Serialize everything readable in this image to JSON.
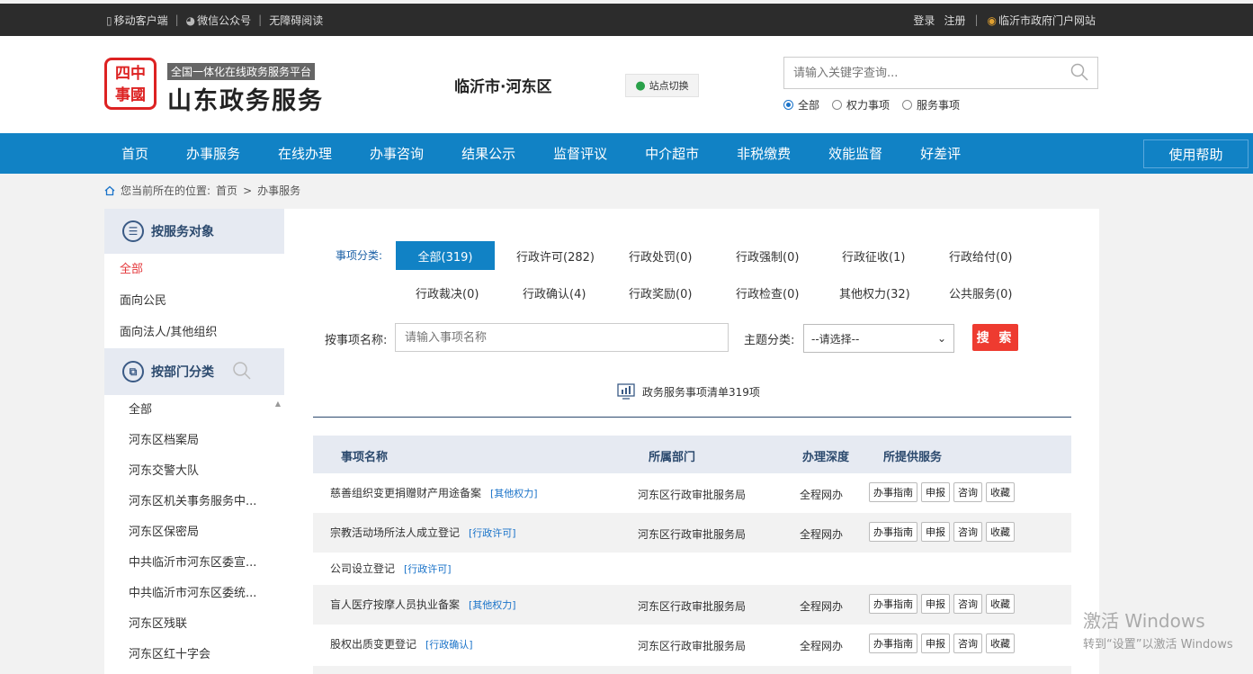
{
  "topbar": {
    "mobile": "移动客户端",
    "wechat": "微信公众号",
    "accessible": "无障碍阅读",
    "login": "登录",
    "register": "注册",
    "portal": "临沂市政府门户网站"
  },
  "header": {
    "seal_text": "四中\n事國",
    "tagline": "全国一体化在线政务服务平台",
    "brand": "山东政务服务",
    "city": "临沂市·河东区",
    "switch_label": "站点切换",
    "search_placeholder": "请输入关键字查询...",
    "radios": [
      "全部",
      "权力事项",
      "服务事项"
    ]
  },
  "nav": {
    "items": [
      "首页",
      "办事服务",
      "在线办理",
      "办事咨询",
      "结果公示",
      "监督评议",
      "中介超市",
      "非税缴费",
      "效能监督",
      "好差评"
    ],
    "help": "使用帮助"
  },
  "breadcrumb": {
    "prefix": "您当前所在的位置:",
    "home": "首页",
    "arrow": ">",
    "current": "办事服务"
  },
  "sidebar": {
    "by_target": "按服务对象",
    "target_items": [
      "全部",
      "面向公民",
      "面向法人/其他组织"
    ],
    "by_dept": "按部门分类",
    "dept_items": [
      "全部",
      "河东区档案局",
      "河东交警大队",
      "河东区机关事务服务中...",
      "河东区保密局",
      "中共临沂市河东区委宣...",
      "中共临沂市河东区委统...",
      "河东区残联",
      "河东区红十字会"
    ]
  },
  "filters": {
    "category_label": "事项分类:",
    "categories": [
      "全部(319)",
      "行政许可(282)",
      "行政处罚(0)",
      "行政强制(0)",
      "行政征收(1)",
      "行政给付(0)",
      "行政裁决(0)",
      "行政确认(4)",
      "行政奖励(0)",
      "行政检查(0)",
      "其他权力(32)",
      "公共服务(0)"
    ],
    "name_label": "按事项名称:",
    "name_placeholder": "请输入事项名称",
    "topic_label": "主题分类:",
    "topic_value": "--请选择--",
    "search_btn": "搜 索"
  },
  "summary": "政务服务事项清单319项",
  "table": {
    "headers": [
      "事项名称",
      "所属部门",
      "办理深度",
      "所提供服务"
    ],
    "actions": [
      "办事指南",
      "申报",
      "咨询",
      "收藏"
    ],
    "rows": [
      {
        "name": "慈善组织变更捐赠财产用途备案",
        "tag": "[其他权力]",
        "dept": "河东区行政审批服务局",
        "depth": "全程网办"
      },
      {
        "name": "宗教活动场所法人成立登记",
        "tag": "[行政许可]",
        "dept": "河东区行政审批服务局",
        "depth": "全程网办"
      },
      {
        "name": "公司设立登记",
        "tag": "[行政许可]",
        "dept": "",
        "depth": ""
      },
      {
        "name": "盲人医疗按摩人员执业备案",
        "tag": "[其他权力]",
        "dept": "河东区行政审批服务局",
        "depth": "全程网办"
      },
      {
        "name": "股权出质变更登记",
        "tag": "[行政确认]",
        "dept": "河东区行政审批服务局",
        "depth": "全程网办"
      }
    ]
  },
  "watermark": {
    "line1": "激活 Windows",
    "line2": "转到“设置”以激活 Windows"
  }
}
